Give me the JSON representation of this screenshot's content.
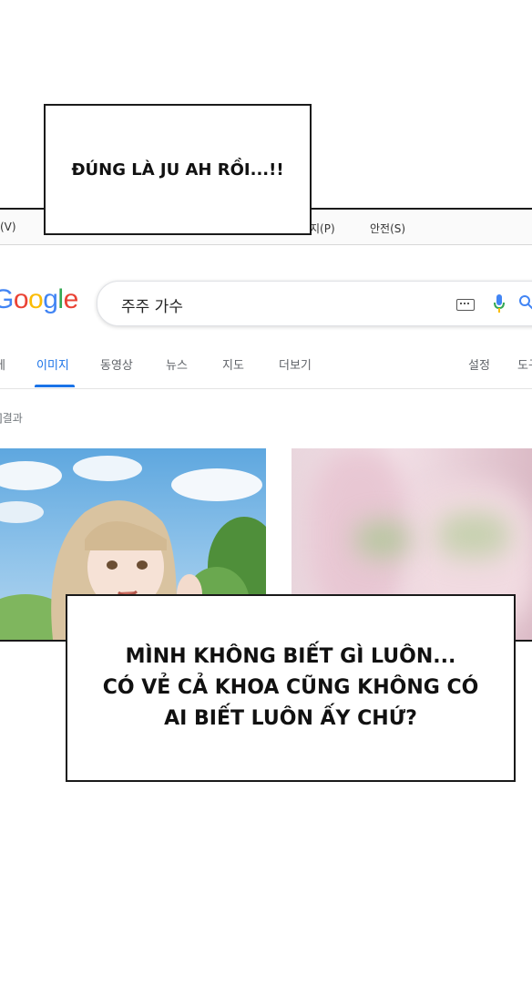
{
  "speech": {
    "top": "ĐÚNG LÀ JU AH RỒI...!!",
    "bottom": "MÌNH KHÔNG BIẾT GÌ LUÔN...\nCÓ VẺ CẢ KHOA CŨNG KHÔNG CÓ\nAI BIẾT LUÔN ẤY CHỨ?"
  },
  "browser": {
    "menu": {
      "view": "(V)",
      "help": "지(P)",
      "safety": "안전(S)"
    },
    "logo": {
      "part1": "G",
      "o1": "o",
      "o2": "o",
      "g": "g",
      "l": "l",
      "e": "e"
    },
    "search": {
      "query": "주주 가수"
    },
    "tabs": [
      "에",
      "이미지",
      "동영상",
      "뉴스",
      "지도",
      "더보기",
      "설정",
      "도구"
    ],
    "active_tab": "이미지",
    "results_label": "]결과",
    "icons": [
      "keyboard-icon",
      "mic-icon",
      "search-lens-icon"
    ]
  },
  "colors": {
    "active_tab": "#1a73e8",
    "google_blue": "#4285f4",
    "google_red": "#ea4335",
    "google_yellow": "#fbbc05",
    "google_green": "#34a853"
  }
}
